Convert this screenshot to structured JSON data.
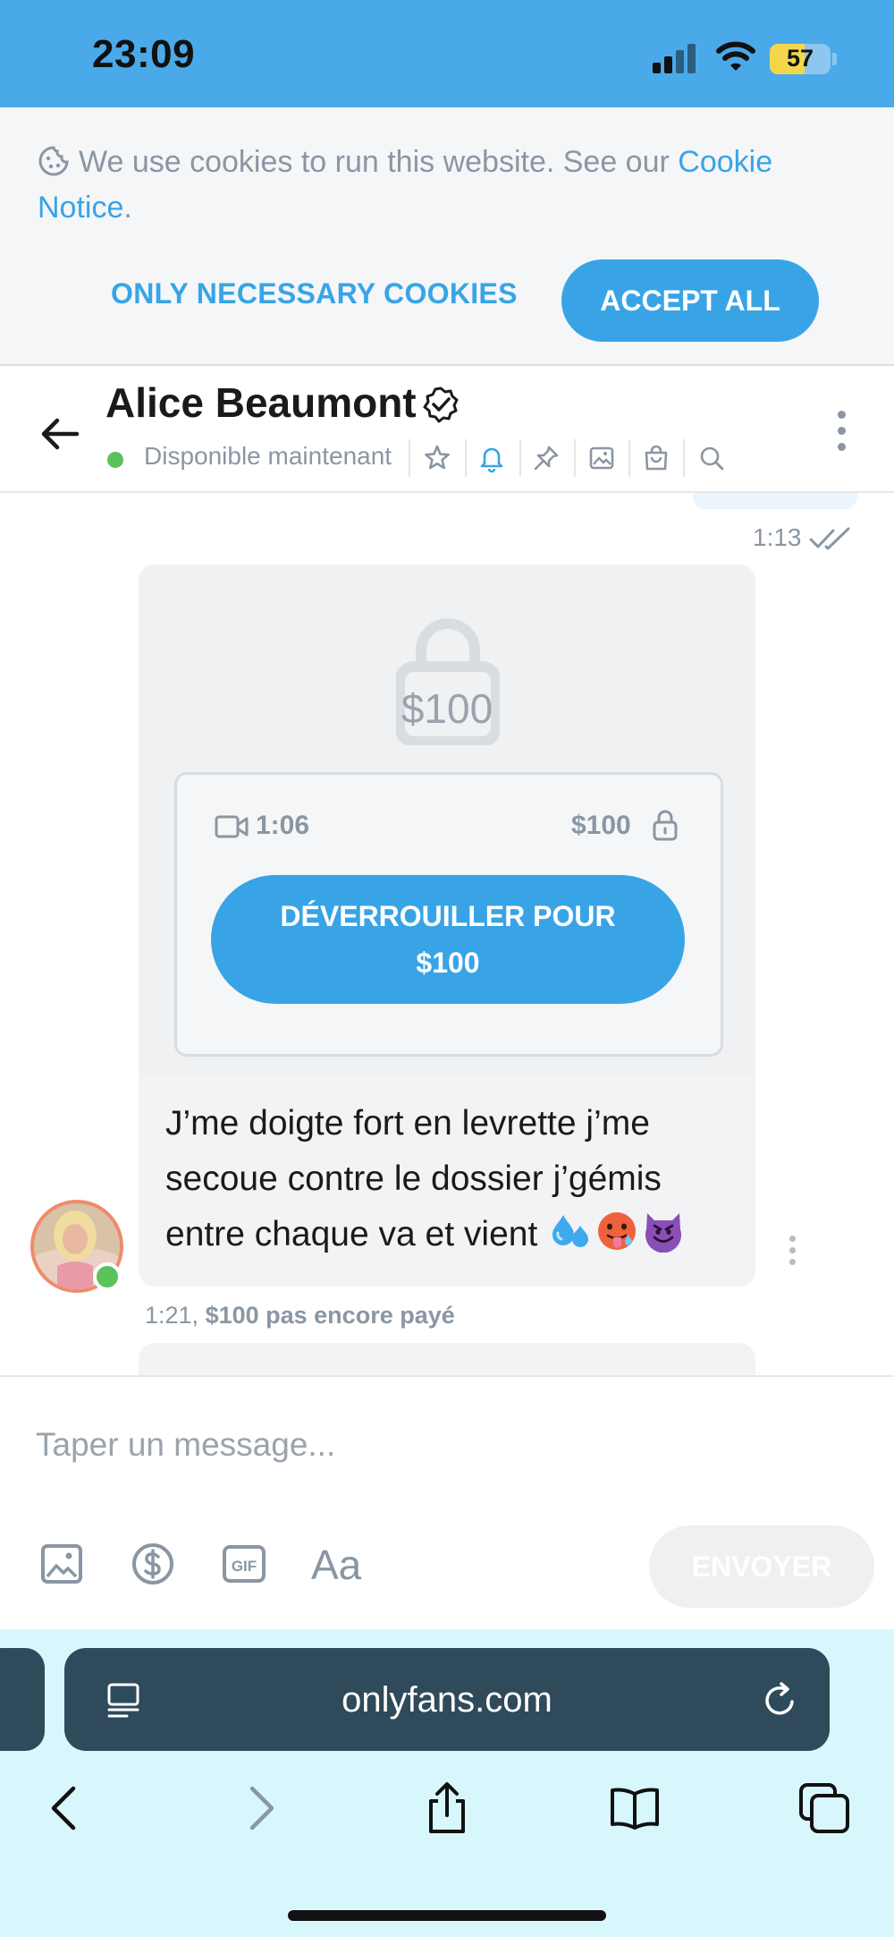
{
  "status_bar": {
    "time": "23:09",
    "battery": "57",
    "battery_level": 0.57
  },
  "cookie_banner": {
    "text": "We use cookies to run this website. See our ",
    "link": "Cookie Notice",
    "after": ".",
    "necessary_label": "ONLY NECESSARY COOKIES",
    "accept_label": "ACCEPT ALL"
  },
  "chat_header": {
    "name": "Alice Beaumont",
    "presence": "Disponible maintenant",
    "icons": [
      "star-icon",
      "bell-icon",
      "pin-icon",
      "image-icon",
      "shopping-bag-icon",
      "search-icon"
    ]
  },
  "messages": {
    "previous_time": "1:13",
    "ppv": {
      "lock_price": "$100",
      "duration": "1:06",
      "price": "$100",
      "unlock_line1": "DÉVERROUILLER POUR",
      "unlock_line2": "$100",
      "text": "J’me doigte fort en levrette j’me secoue contre le dossier j’gémis entre chaque va et vient",
      "emojis": [
        "sweat-droplets",
        "hot-face",
        "smiling-imp"
      ],
      "time": "1:21,",
      "status": "$100 pas encore payé"
    }
  },
  "composer": {
    "placeholder": "Taper un message...",
    "tools": [
      "image-icon",
      "dollar-icon",
      "gif-icon",
      "text-format-icon"
    ],
    "send_label": "ENVOYER"
  },
  "browser": {
    "url": "onlyfans.com",
    "nav": [
      "back-icon",
      "forward-icon",
      "share-icon",
      "bookmarks-icon",
      "tabs-icon"
    ]
  },
  "colors": {
    "accent": "#38a4e6",
    "status_bar": "#4aa9e8",
    "online": "#5bc25b",
    "muted": "#8a96a3",
    "browser_bar": "#2f4a5a"
  }
}
